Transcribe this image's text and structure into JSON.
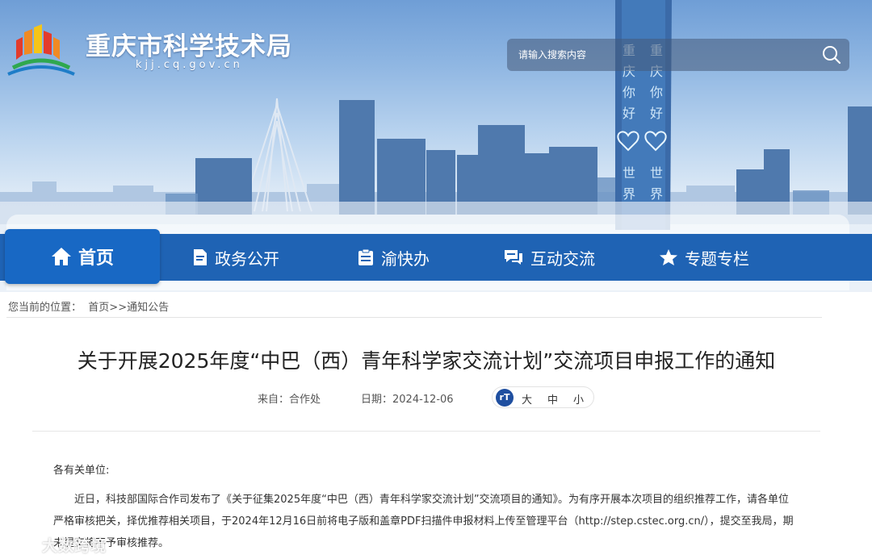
{
  "header": {
    "site_title": "重庆市科学技术局",
    "site_domain": "kjj.cq.gov.cn",
    "search_placeholder": "请输入搜索内容"
  },
  "nav": {
    "items": [
      {
        "label": "首页",
        "icon": "home-icon",
        "active": true
      },
      {
        "label": "政务公开",
        "icon": "document-icon"
      },
      {
        "label": "渝快办",
        "icon": "clipboard-icon"
      },
      {
        "label": "互动交流",
        "icon": "chat-icon"
      },
      {
        "label": "专题专栏",
        "icon": "star-icon"
      }
    ]
  },
  "breadcrumb": {
    "prefix": "您当前的位置：",
    "home": "首页",
    "sep": ">>",
    "current": "通知公告"
  },
  "article": {
    "title": "关于开展2025年度“中巴（西）青年科学家交流计划”交流项目申报工作的通知",
    "source": "来自：合作处",
    "date": "日期：2024-12-06",
    "font_icon_label": "rT",
    "font_large": "大",
    "font_medium": "中",
    "font_small": "小",
    "greeting": "各有关单位:",
    "body": "近日，科技部国际合作司发布了《关于征集2025年度“中巴（西）青年科学家交流计划”交流项目的通知》。为有序开展本次项目的组织推荐工作，请各单位严格审核把关，择优推荐相关项目，于2024年12月16日前将电子版和盖章PDF扫描件申报材料上传至管理平台（http://step.cstec.org.cn/），提交至我局，期未提交将不予审核推荐。"
  },
  "watermark": {
    "text": "大数跨境"
  },
  "colors": {
    "nav_bg": "#1f63b4",
    "nav_active": "#1868c4",
    "title_text": "#222222"
  }
}
